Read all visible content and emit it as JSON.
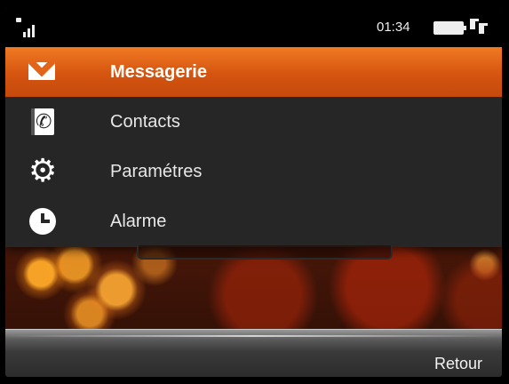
{
  "status_bar": {
    "signal_icon": "signal-strength-icon",
    "time": "01:34",
    "battery_icon": "battery-full-icon",
    "network_icon": "data-transfer-icon"
  },
  "menu": {
    "selected_index": 0,
    "accent_color": "#e0661a",
    "items": [
      {
        "label": "Messagerie",
        "icon": "envelope-icon"
      },
      {
        "label": "Contacts",
        "icon": "contacts-icon"
      },
      {
        "label": "Paramétres",
        "icon": "gear-icon"
      },
      {
        "label": "Alarme",
        "icon": "clock-icon"
      }
    ]
  },
  "softkeys": {
    "right": "Retour"
  }
}
